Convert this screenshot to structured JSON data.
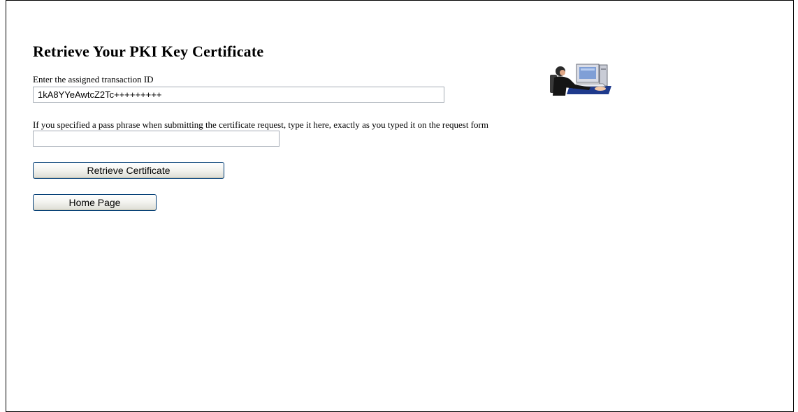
{
  "page": {
    "title": "Retrieve Your PKI Key Certificate"
  },
  "form": {
    "transaction_label": "Enter the assigned transaction ID",
    "transaction_value": "1kA8YYeAwtcZ2Tc+++++++++",
    "passphrase_label": "If you specified a pass phrase when submitting the certificate request, type it here, exactly as you typed it on the request form",
    "passphrase_value": ""
  },
  "buttons": {
    "retrieve_label": "Retrieve Certificate",
    "home_label": "Home Page"
  },
  "illustration": {
    "icon": "person-at-computer-icon"
  }
}
